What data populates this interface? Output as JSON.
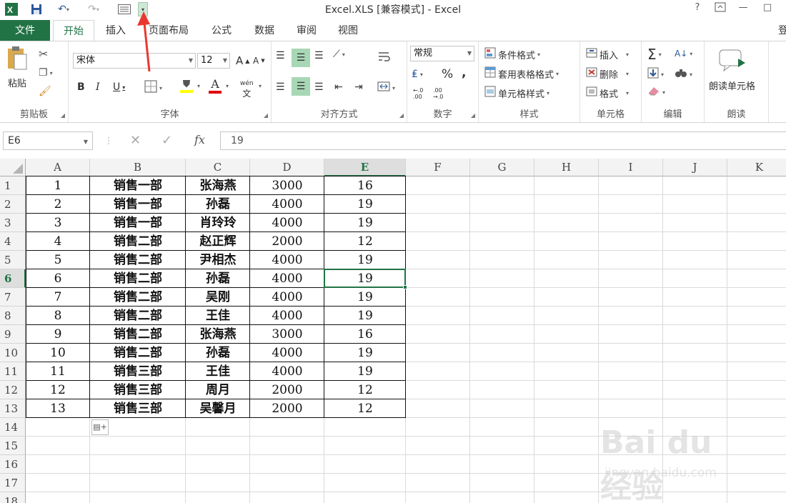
{
  "titlebar": {
    "title": "Excel.XLS  [兼容模式] - Excel",
    "help": "?",
    "minimize": "—",
    "restore": "□"
  },
  "ribbon_tabs": {
    "file": "文件",
    "tabs": [
      "开始",
      "插入",
      "页面布局",
      "公式",
      "数据",
      "审阅",
      "视图"
    ],
    "overflow": "登"
  },
  "clipboard": {
    "paste": "粘贴",
    "label": "剪贴板"
  },
  "font": {
    "name": "宋体",
    "size": "12",
    "label": "字体",
    "bold": "B",
    "italic": "I",
    "underline": "U",
    "grow": "A",
    "shrink": "A",
    "font_color_letter": "A",
    "phonetic": "wén"
  },
  "alignment": {
    "label": "对齐方式"
  },
  "number": {
    "format": "常规",
    "label": "数字",
    "percent": "%",
    "comma": ",",
    "inc_dec": "←.0 .00",
    "dec_dec": ".00 →.0"
  },
  "styles": {
    "conditional": "条件格式",
    "table": "套用表格格式",
    "cell_style": "单元格样式",
    "label": "样式"
  },
  "cells": {
    "insert": "插入",
    "delete": "删除",
    "format": "格式",
    "label": "单元格"
  },
  "editing": {
    "label": "编辑"
  },
  "read": {
    "button": "朗读单元格",
    "label": "朗读"
  },
  "formula_bar": {
    "name_box": "E6",
    "fx": "fx",
    "value": "19"
  },
  "columns": [
    "A",
    "B",
    "C",
    "D",
    "E",
    "F",
    "G",
    "H",
    "I",
    "J",
    "K"
  ],
  "rows": [
    "1",
    "2",
    "3",
    "4",
    "5",
    "6",
    "7",
    "8",
    "9",
    "10",
    "11",
    "12",
    "13",
    "14",
    "15",
    "16",
    "17",
    "18"
  ],
  "active_cell": "E6",
  "table": [
    [
      "1",
      "销售一部",
      "张海燕",
      "3000",
      "16"
    ],
    [
      "2",
      "销售一部",
      "孙磊",
      "4000",
      "19"
    ],
    [
      "3",
      "销售一部",
      "肖玲玲",
      "4000",
      "19"
    ],
    [
      "4",
      "销售二部",
      "赵正辉",
      "2000",
      "12"
    ],
    [
      "5",
      "销售二部",
      "尹相杰",
      "4000",
      "19"
    ],
    [
      "6",
      "销售二部",
      "孙磊",
      "4000",
      "19"
    ],
    [
      "7",
      "销售二部",
      "吴刚",
      "4000",
      "19"
    ],
    [
      "8",
      "销售二部",
      "王佳",
      "4000",
      "19"
    ],
    [
      "9",
      "销售二部",
      "张海燕",
      "3000",
      "16"
    ],
    [
      "10",
      "销售二部",
      "孙磊",
      "4000",
      "19"
    ],
    [
      "11",
      "销售三部",
      "王佳",
      "4000",
      "19"
    ],
    [
      "12",
      "销售三部",
      "周月",
      "2000",
      "12"
    ],
    [
      "13",
      "销售三部",
      "吴馨月",
      "2000",
      "12"
    ]
  ],
  "watermark": {
    "main": "Bai du 经验",
    "url": "jingyan.baidu.com"
  },
  "colors": {
    "excel_green": "#217346",
    "arrow_red": "#e8382f"
  }
}
